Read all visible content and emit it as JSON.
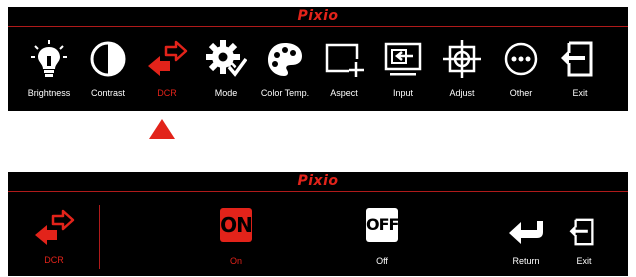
{
  "brand": "Pixio",
  "colors": {
    "accent": "#e2231a",
    "background": "#000000",
    "text": "#ffffff"
  },
  "main_menu": {
    "items": [
      {
        "label": "Brightness",
        "icon": "brightness-bulb-icon",
        "active": false
      },
      {
        "label": "Contrast",
        "icon": "contrast-icon",
        "active": false
      },
      {
        "label": "DCR",
        "icon": "dcr-arrows-icon",
        "active": true
      },
      {
        "label": "Mode",
        "icon": "mode-gear-icon",
        "active": false
      },
      {
        "label": "Color Temp.",
        "icon": "palette-icon",
        "active": false
      },
      {
        "label": "Aspect",
        "icon": "aspect-icon",
        "active": false
      },
      {
        "label": "Input",
        "icon": "input-icon",
        "active": false
      },
      {
        "label": "Adjust",
        "icon": "crosshair-icon",
        "active": false
      },
      {
        "label": "Other",
        "icon": "more-dots-icon",
        "active": false
      },
      {
        "label": "Exit",
        "icon": "exit-icon",
        "active": false
      }
    ]
  },
  "selection_indicator": "up-triangle-icon",
  "submenu": {
    "current": {
      "label": "DCR",
      "icon": "dcr-arrows-icon"
    },
    "on": {
      "badge": "ON",
      "label": "On",
      "selected": true
    },
    "off": {
      "badge": "OFF",
      "label": "Off",
      "selected": false
    },
    "return": {
      "label": "Return",
      "icon": "return-arrow-icon"
    },
    "exit": {
      "label": "Exit",
      "icon": "exit-icon"
    }
  }
}
